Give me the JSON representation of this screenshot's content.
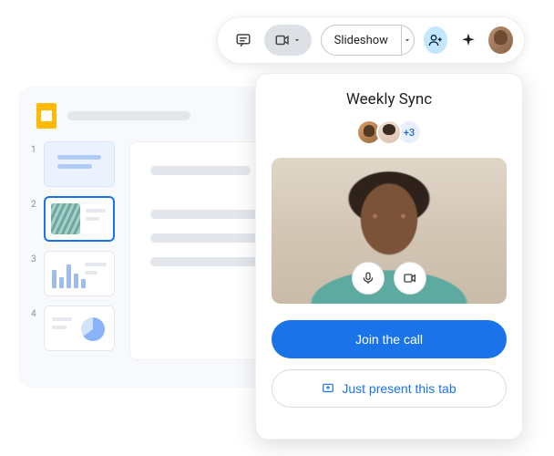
{
  "toolbar": {
    "slideshow_label": "Slideshow"
  },
  "slides": {
    "thumb_numbers": [
      "1",
      "2",
      "3",
      "4"
    ]
  },
  "meet": {
    "title": "Weekly Sync",
    "more_count": "+3",
    "join_label": "Join the call",
    "present_label": "Just present this tab"
  }
}
